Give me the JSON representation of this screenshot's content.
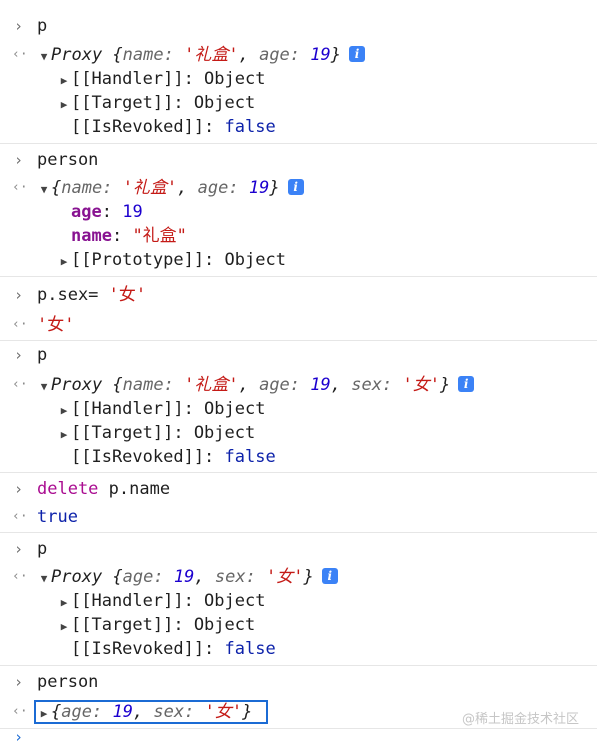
{
  "console": {
    "entries": [
      {
        "input": "p",
        "output_obj": "Proxy",
        "output_props": [
          [
            "name",
            "'礼盒'"
          ],
          [
            "age",
            "19"
          ]
        ],
        "tree": [
          "[[Handler]]: Object",
          "[[Target]]: Object"
        ],
        "revoked_label": "[[IsRevoked]]:",
        "revoked_value": "false"
      },
      {
        "input": "person",
        "output_props": [
          [
            "name",
            "'礼盒'"
          ],
          [
            "age",
            "19"
          ]
        ],
        "expanded": [
          {
            "key": "age",
            "value": "19"
          },
          {
            "key": "name",
            "value": "\"礼盒\""
          }
        ],
        "proto": "[[Prototype]]: Object"
      },
      {
        "input": "p.sex= '女'",
        "input_code": "p.sex=",
        "input_str": "'女'",
        "result": "'女'"
      },
      {
        "input": "p",
        "output_obj": "Proxy",
        "output_props": [
          [
            "name",
            "'礼盒'"
          ],
          [
            "age",
            "19"
          ],
          [
            "sex",
            "'女'"
          ]
        ],
        "tree": [
          "[[Handler]]: Object",
          "[[Target]]: Object"
        ],
        "revoked_label": "[[IsRevoked]]:",
        "revoked_value": "false"
      },
      {
        "input_kw": "delete",
        "input_code": "p.name",
        "result": "true"
      },
      {
        "input": "p",
        "output_obj": "Proxy",
        "output_props": [
          [
            "age",
            "19"
          ],
          [
            "sex",
            "'女'"
          ]
        ],
        "tree": [
          "[[Handler]]: Object",
          "[[Target]]: Object"
        ],
        "revoked_label": "[[IsRevoked]]:",
        "revoked_value": "false"
      },
      {
        "input": "person",
        "output_props": [
          [
            "age",
            "19"
          ],
          [
            "sex",
            "'女'"
          ]
        ]
      }
    ],
    "info_icon": "i",
    "prompt_glyph": "›",
    "return_glyph": "‹·",
    "collapsed_glyph": "▶",
    "expanded_glyph": "▼"
  },
  "watermark": "@稀土掘金技术社区"
}
